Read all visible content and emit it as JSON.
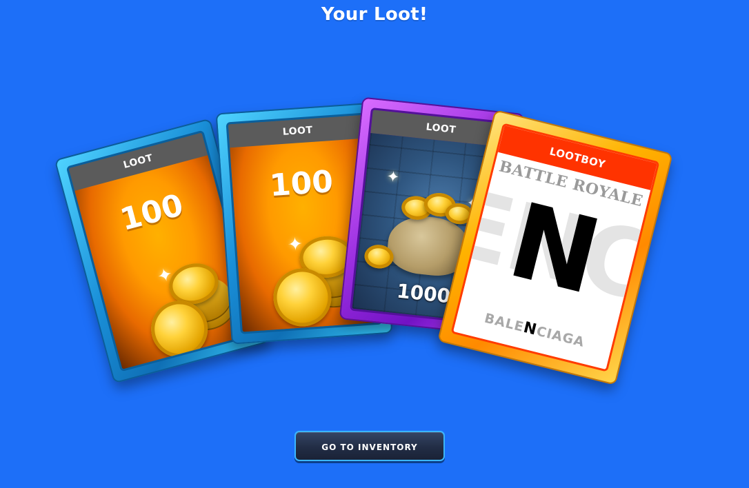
{
  "page": {
    "title": "Your Loot!"
  },
  "cards": [
    {
      "header": "LOOT",
      "amount": "100",
      "art": "gold-coins-icon",
      "rarity_color": "#1a8fd8"
    },
    {
      "header": "LOOT",
      "amount": "100",
      "art": "gold-coins-icon",
      "rarity_color": "#1a8fd8"
    },
    {
      "header": "LOOT",
      "amount": "1000",
      "art": "coin-sack-icon",
      "rarity_color": "#9a2ee0"
    },
    {
      "header": "LOOTBOY",
      "subtitle": "BATTLE ROYALE",
      "ghost_text": "ENC",
      "center_letter": "N",
      "brand_prefix": "BALE",
      "brand_highlight": "N",
      "brand_suffix": "CIAGA",
      "rarity_color": "#ffb300"
    }
  ],
  "actions": {
    "inventory_button": "GO TO INVENTORY"
  },
  "colors": {
    "background": "#1d6ff8",
    "header_gray": "#5b5b5b",
    "lootboy_red": "#ff3300",
    "button_border": "#3bb6ff"
  }
}
